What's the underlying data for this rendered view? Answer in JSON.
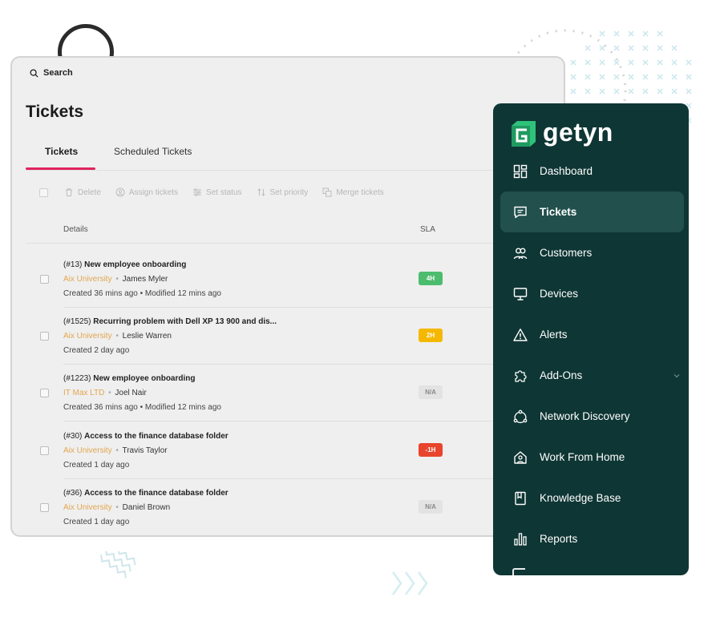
{
  "search": {
    "label": "Search"
  },
  "page": {
    "title": "Tickets"
  },
  "tabs": [
    {
      "label": "Tickets",
      "active": true
    },
    {
      "label": "Scheduled Tickets",
      "active": false
    }
  ],
  "toolbar": {
    "actions": [
      {
        "label": "Delete",
        "icon": "trash-icon"
      },
      {
        "label": "Assign tickets",
        "icon": "assign-user-icon"
      },
      {
        "label": "Set status",
        "icon": "sliders-icon"
      },
      {
        "label": "Set priority",
        "icon": "sort-arrows-icon"
      },
      {
        "label": "Merge tickets",
        "icon": "merge-icon"
      }
    ]
  },
  "table": {
    "columns": {
      "details": "Details",
      "sla": "SLA"
    },
    "rows": [
      {
        "number": "(#13)",
        "title": "New employee onboarding",
        "org": "Aix University",
        "separator": "•",
        "person": "James Myler",
        "meta": "Created 36 mins ago  •  Modified 12 mins ago",
        "sla": "4H",
        "sla_color": "#4cbc6e"
      },
      {
        "number": "(#1525)",
        "title": "Recurring problem with Dell XP 13 900 and dis...",
        "org": "Aix University",
        "separator": "•",
        "person": "Leslie Warren",
        "meta": "Created 2 day ago",
        "sla": "2H",
        "sla_color": "#f5b800"
      },
      {
        "number": "(#1223)",
        "title": "New employee onboarding",
        "org": "IT Max LTD",
        "separator": "•",
        "person": "Joel Nair",
        "meta": "Created 36 mins ago  •  Modified 12 mins ago",
        "sla": "N/A",
        "sla_color": "#e3e3e3"
      },
      {
        "number": "(#30)",
        "title": "Access to the finance database folder",
        "org": "Aix University",
        "separator": "•",
        "person": "Travis Taylor",
        "meta": "Created 1 day ago",
        "sla": "-1H",
        "sla_color": "#e8452c"
      },
      {
        "number": "(#36)",
        "title": "Access to the finance database folder",
        "org": "Aix University",
        "separator": "•",
        "person": "Daniel Brown",
        "meta": "Created 1 day ago",
        "sla": "N/A",
        "sla_color": "#e3e3e3"
      }
    ]
  },
  "sidebar": {
    "brand": "getyn",
    "items": [
      {
        "label": "Dashboard",
        "icon": "dashboard-icon",
        "active": false
      },
      {
        "label": "Tickets",
        "icon": "ticket-chat-icon",
        "active": true
      },
      {
        "label": "Customers",
        "icon": "customers-icon",
        "active": false
      },
      {
        "label": "Devices",
        "icon": "monitor-icon",
        "active": false
      },
      {
        "label": "Alerts",
        "icon": "alert-triangle-icon",
        "active": false
      },
      {
        "label": "Add-Ons",
        "icon": "puzzle-icon",
        "active": false
      },
      {
        "label": "Network Discovery",
        "icon": "network-icon",
        "active": false
      },
      {
        "label": "Work From Home",
        "icon": "home-user-icon",
        "active": false
      },
      {
        "label": "Knowledge Base",
        "icon": "book-icon",
        "active": false
      },
      {
        "label": "Reports",
        "icon": "bar-chart-icon",
        "active": false
      }
    ]
  },
  "colors": {
    "sidebar_bg": "#0e3634",
    "sidebar_active": "#21504d",
    "tab_accent": "#e0245e",
    "org_text": "#e2a64f",
    "brand_green": "#2fc27a"
  }
}
